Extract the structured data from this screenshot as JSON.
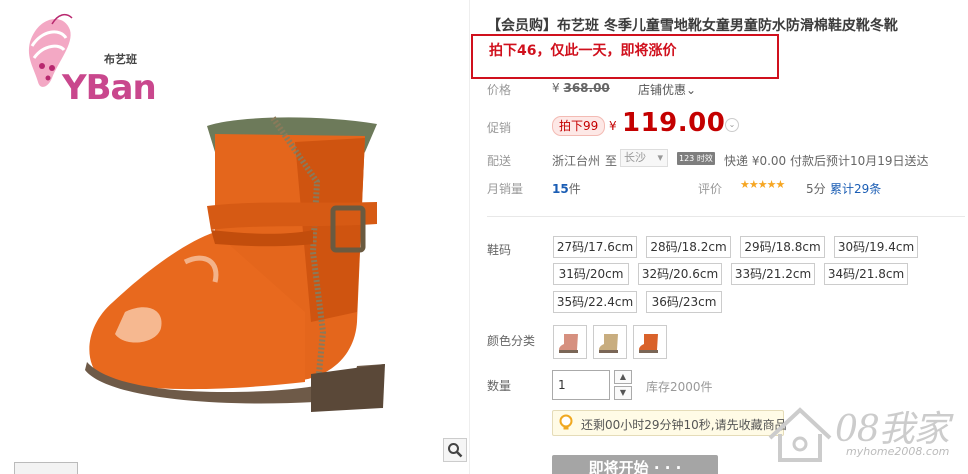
{
  "brand": {
    "logo_text": "YBan",
    "logo_cn": "布艺班"
  },
  "product": {
    "title": "【会员购】布艺班 冬季儿童雪地靴女童男童防水防滑棉鞋皮靴冬靴",
    "promo_note": "拍下46，仅此一天，即将涨价"
  },
  "price": {
    "label": "价格",
    "yen": "¥",
    "original": "368.00",
    "store_discount": "店铺优惠",
    "store_discount_arrow": "⌄"
  },
  "sale": {
    "label": "促销",
    "badge": "拍下99",
    "yen": "¥",
    "price": "119.00",
    "toggle": "⌄"
  },
  "delivery": {
    "label": "配送",
    "from": "浙江台州",
    "to_word": "至",
    "city": "长沙",
    "city_arrow": "▾",
    "time_badge": "123 时效",
    "express": "快递 ¥0.00 付款后预计10月19日送达"
  },
  "monthly_sales": {
    "label": "月销量",
    "count": "15",
    "unit": "件"
  },
  "rating": {
    "label": "评价",
    "stars": "★★★★★",
    "score": "5分",
    "total": "累计29条"
  },
  "sizes": {
    "label": "鞋码",
    "options": [
      "27码/17.6cm",
      "28码/18.2cm",
      "29码/18.8cm",
      "30码/19.4cm",
      "31码/20cm",
      "32码/20.6cm",
      "33码/21.2cm",
      "34码/21.8cm",
      "35码/22.4cm",
      "36码/23cm"
    ]
  },
  "colors": {
    "label": "颜色分类",
    "swatches": [
      "#d6907f",
      "#c8ad7f",
      "#d9622a"
    ]
  },
  "quantity": {
    "label": "数量",
    "value": "1",
    "up": "▲",
    "down": "▼",
    "stock": "库存2000件"
  },
  "reminder": {
    "text": "还剩00小时29分钟10秒,请先收藏商品"
  },
  "buy_button": {
    "label": "即将开始 · · ·"
  },
  "watermark": {
    "main": "08我家",
    "url": "myhome2008.com"
  }
}
